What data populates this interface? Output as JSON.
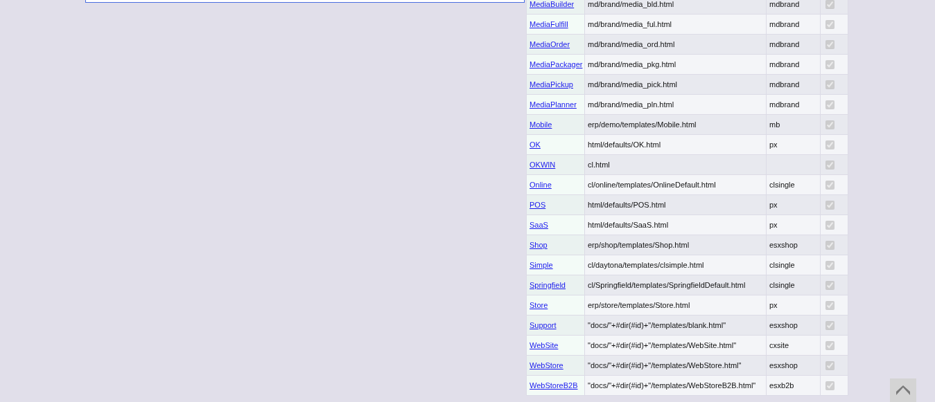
{
  "rows": [
    {
      "name": "MediaBuilder",
      "path": "md/brand/media_bld.html",
      "skin": "mdbrand",
      "checked": true
    },
    {
      "name": "MediaFulfill",
      "path": "md/brand/media_ful.html",
      "skin": "mdbrand",
      "checked": true
    },
    {
      "name": "MediaOrder",
      "path": "md/brand/media_ord.html",
      "skin": "mdbrand",
      "checked": true
    },
    {
      "name": "MediaPackager",
      "path": "md/brand/media_pkg.html",
      "skin": "mdbrand",
      "checked": true
    },
    {
      "name": "MediaPickup",
      "path": "md/brand/media_pick.html",
      "skin": "mdbrand",
      "checked": true
    },
    {
      "name": "MediaPlanner",
      "path": "md/brand/media_pln.html",
      "skin": "mdbrand",
      "checked": true
    },
    {
      "name": "Mobile",
      "path": "erp/demo/templates/Mobile.html",
      "skin": "mb",
      "checked": true
    },
    {
      "name": "OK",
      "path": "html/defaults/OK.html",
      "skin": "px",
      "checked": true
    },
    {
      "name": "OKWIN",
      "path": "cl.html",
      "checked": true
    },
    {
      "name": "Online",
      "path": "cl/online/templates/OnlineDefault.html",
      "skin": "clsingle",
      "checked": true
    },
    {
      "name": "POS",
      "path": "html/defaults/POS.html",
      "skin": "px",
      "checked": true
    },
    {
      "name": "SaaS",
      "path": "html/defaults/SaaS.html",
      "skin": "px",
      "checked": true
    },
    {
      "name": "Shop",
      "path": "erp/shop/templates/Shop.html",
      "skin": "esxshop",
      "checked": true
    },
    {
      "name": "Simple",
      "path": "cl/daytona/templates/clsimple.html",
      "skin": "clsingle",
      "checked": true
    },
    {
      "name": "Springfield",
      "path": "cl/Springfield/templates/SpringfieldDefault.html",
      "skin": "clsingle",
      "checked": true
    },
    {
      "name": "Store",
      "path": "erp/store/templates/Store.html",
      "skin": "px",
      "checked": true
    },
    {
      "name": "Support",
      "path": "\"docs/\"+#dir(#id)+\"/templates/blank.html\"",
      "skin": "esxshop",
      "checked": true
    },
    {
      "name": "WebSite",
      "path": "\"docs/\"+#dir(#id)+\"/templates/WebSite.html\"",
      "skin": "cxsite",
      "checked": true
    },
    {
      "name": "WebStore",
      "path": "\"docs/\"+#dir(#id)+\"/templates/WebStore.html\"",
      "skin": "esxshop",
      "checked": true
    },
    {
      "name": "WebStoreB2B",
      "path": "\"docs/\"+#dir(#id)+\"/templates/WebStoreB2B.html\"",
      "skin": "esxb2b",
      "checked": true
    }
  ]
}
